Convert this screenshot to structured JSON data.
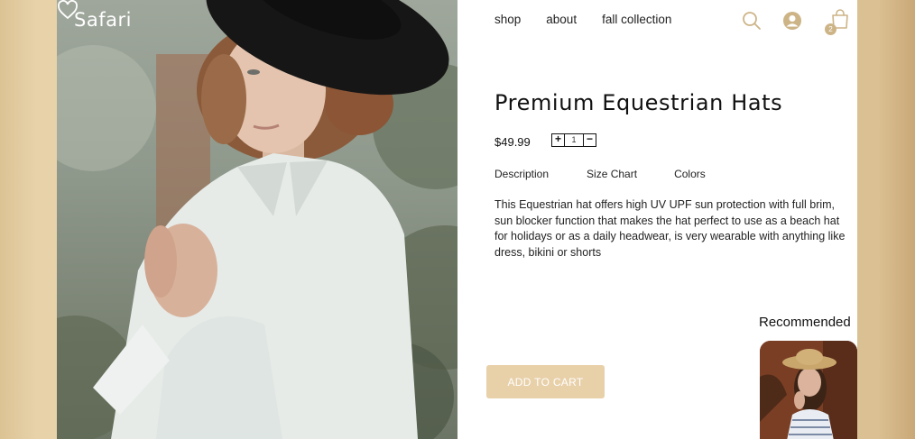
{
  "brand": {
    "name": "Safari"
  },
  "nav": {
    "items": [
      {
        "label": "shop"
      },
      {
        "label": "about"
      },
      {
        "label": "fall collection"
      }
    ],
    "cart_count": "2",
    "icons": [
      "search-icon",
      "user-icon",
      "cart-icon"
    ]
  },
  "product": {
    "title": "Premium Equestrian Hats",
    "price": "$49.99",
    "quantity": "1",
    "stepper": {
      "plus": "+",
      "minus": "−"
    },
    "tabs": [
      {
        "label": "Description"
      },
      {
        "label": "Size Chart"
      },
      {
        "label": "Colors"
      }
    ],
    "description": "This Equestrian hat offers high UV UPF sun protection with full brim, sun blocker function that makes the hat perfect to use as a beach hat for holidays or as a daily headwear, is very wearable with anything like dress, bikini or shorts",
    "add_to_cart_label": "ADD TO CART"
  },
  "recommended": {
    "title": "Recommended"
  },
  "colors": {
    "accent": "#e8d0a9",
    "icon": "#cdb487",
    "background": "#e4cfa6"
  }
}
